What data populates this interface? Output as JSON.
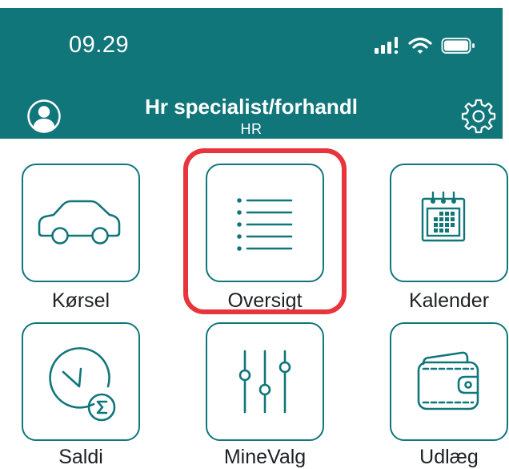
{
  "status_bar": {
    "time": "09.29",
    "icons": [
      "signal-icon",
      "wifi-icon",
      "battery-icon"
    ]
  },
  "header": {
    "title": "Hr specialist/forhandl",
    "subtitle": "HR",
    "left_icon": "user-avatar-icon",
    "right_icon": "gear-icon"
  },
  "menu": {
    "items": [
      {
        "label": "Kørsel",
        "icon": "car-icon"
      },
      {
        "label": "Oversigt",
        "icon": "list-icon",
        "highlighted": true
      },
      {
        "label": "Kalender",
        "icon": "calendar-icon"
      },
      {
        "label": "Saldi",
        "icon": "clock-sum-icon"
      },
      {
        "label": "MineValg",
        "icon": "sliders-icon"
      },
      {
        "label": "Udlæg",
        "icon": "wallet-icon"
      }
    ]
  },
  "colors": {
    "accent": "#11767a",
    "highlight": "#e8353c",
    "label_text": "#1d2124"
  }
}
